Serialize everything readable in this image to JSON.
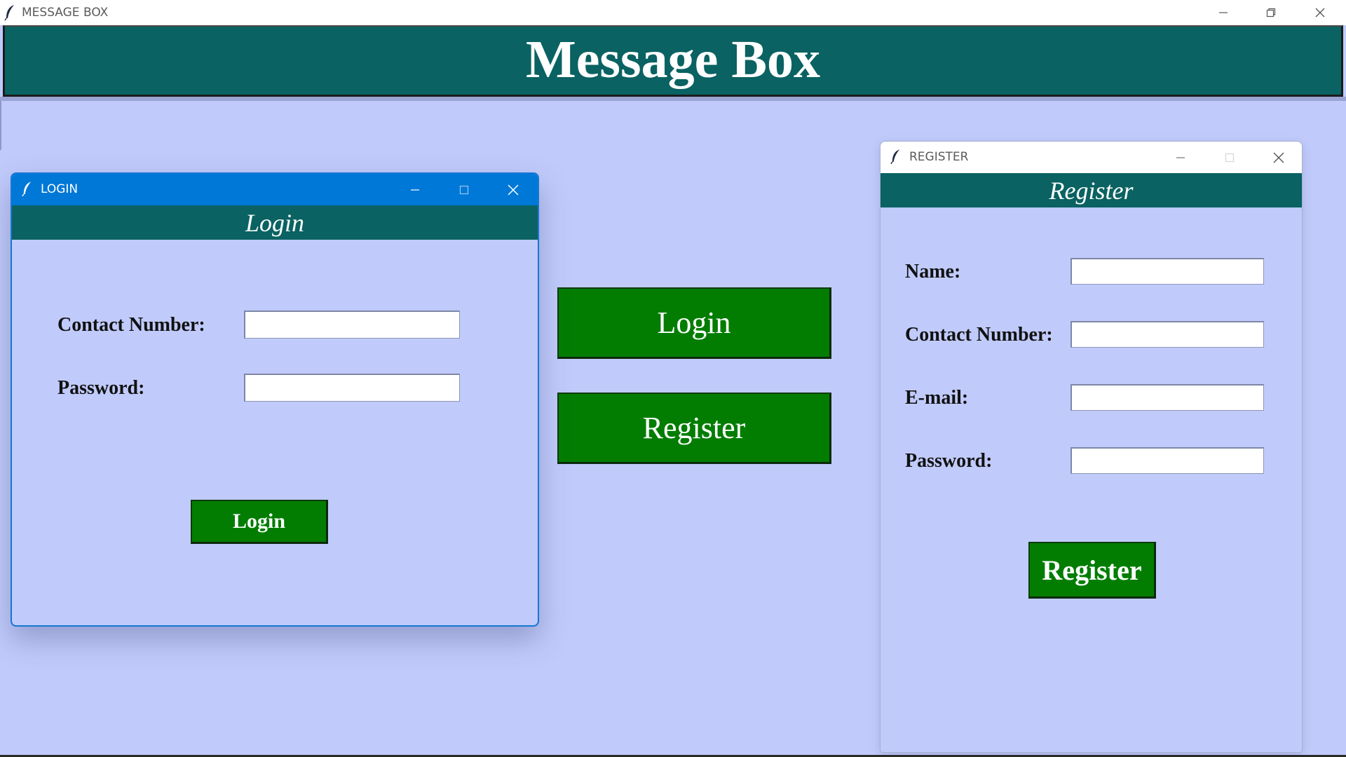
{
  "main_window": {
    "title": "MESSAGE BOX",
    "banner_title": "Message Box"
  },
  "center_buttons": {
    "login_label": "Login",
    "register_label": "Register"
  },
  "login_window": {
    "title": "LOGIN",
    "banner": "Login",
    "fields": {
      "contact_label": "Contact Number:",
      "contact_value": "",
      "password_label": "Password:",
      "password_value": ""
    },
    "submit_label": "Login"
  },
  "register_window": {
    "title": "REGISTER",
    "banner": "Register",
    "fields": {
      "name_label": "Name:",
      "name_value": "",
      "contact_label": "Contact Number:",
      "contact_value": "",
      "email_label": "E-mail:",
      "email_value": "",
      "password_label": "Password:",
      "password_value": ""
    },
    "submit_label": "Register"
  },
  "icons": {
    "app_icon": "feather-icon",
    "minimize": "minimize-icon",
    "maximize": "maximize-icon",
    "restore": "restore-icon",
    "close": "close-icon"
  },
  "colors": {
    "background": "#c0cbfb",
    "banner": "#0a6262",
    "button": "#027d02",
    "active_titlebar": "#0078d7"
  }
}
